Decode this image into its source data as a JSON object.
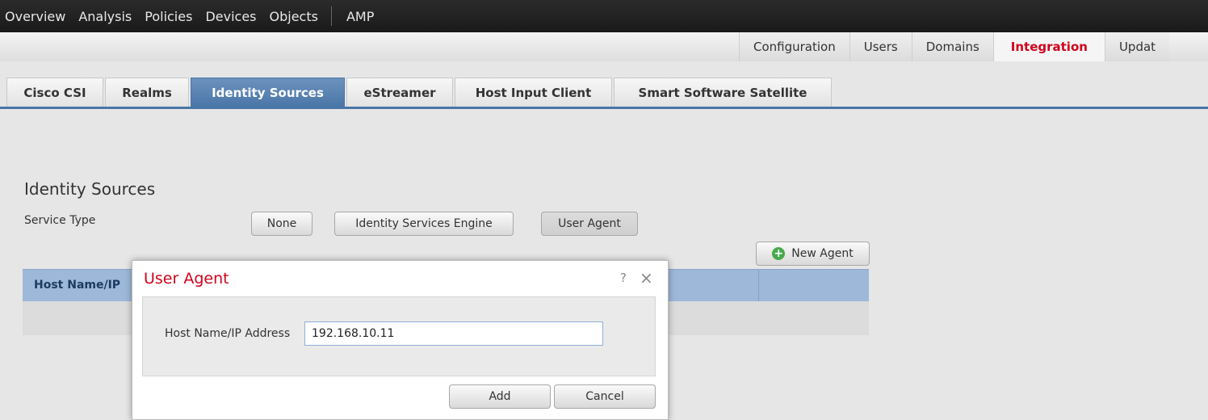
{
  "topnav": [
    "Overview",
    "Analysis",
    "Policies",
    "Devices",
    "Objects",
    "AMP"
  ],
  "subnav": [
    "Configuration",
    "Users",
    "Domains",
    "Integration",
    "Updat"
  ],
  "tabs": [
    "Cisco CSI",
    "Realms",
    "Identity Sources",
    "eStreamer",
    "Host Input Client",
    "Smart Software Satellite"
  ],
  "content": {
    "section_title": "Identity Sources",
    "service_type_label": "Service Type",
    "service_buttons": [
      "None",
      "Identity Services Engine",
      "User Agent"
    ],
    "new_agent_label": "New Agent",
    "table_header": "Host Name/IP"
  },
  "modal": {
    "title": "User Agent",
    "help": "?",
    "close": "×",
    "field_label": "Host Name/IP Address",
    "field_value": "192.168.10.11",
    "add_label": "Add",
    "cancel_label": "Cancel"
  },
  "colors": {
    "accent_red": "#d0021b",
    "active_tab_blue": "#4a76a8",
    "table_header": "#9db8d8"
  }
}
